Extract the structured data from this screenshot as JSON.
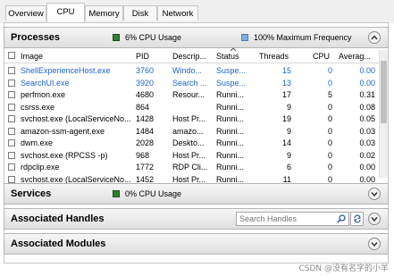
{
  "tabs": [
    {
      "label": "Overview"
    },
    {
      "label": "CPU"
    },
    {
      "label": "Memory"
    },
    {
      "label": "Disk"
    },
    {
      "label": "Network"
    }
  ],
  "active_tab": "CPU",
  "processes": {
    "title": "Processes",
    "cpu_usage": "6% CPU Usage",
    "max_frequency": "100% Maximum Frequency",
    "columns": [
      "Image",
      "PID",
      "Descrip...",
      "Status",
      "Threads",
      "CPU",
      "Averag..."
    ],
    "rows": [
      {
        "image": "ShellExperienceHost.exe",
        "pid": "3760",
        "desc": "Windo...",
        "status": "Suspe...",
        "threads": "15",
        "cpu": "0",
        "avg": "0.00",
        "highlight": true
      },
      {
        "image": "SearchUI.exe",
        "pid": "3920",
        "desc": "Search ...",
        "status": "Suspe...",
        "threads": "13",
        "cpu": "0",
        "avg": "0.00",
        "highlight": true
      },
      {
        "image": "perfmon.exe",
        "pid": "4680",
        "desc": "Resour...",
        "status": "Runni...",
        "threads": "17",
        "cpu": "5",
        "avg": "0.31",
        "highlight": false
      },
      {
        "image": "csrss.exe",
        "pid": "864",
        "desc": "",
        "status": "Runni...",
        "threads": "9",
        "cpu": "0",
        "avg": "0.08",
        "highlight": false
      },
      {
        "image": "svchost.exe (LocalServiceNo...",
        "pid": "1428",
        "desc": "Host Pr...",
        "status": "Runni...",
        "threads": "19",
        "cpu": "0",
        "avg": "0.05",
        "highlight": false
      },
      {
        "image": "amazon-ssm-agent.exe",
        "pid": "1484",
        "desc": "amazo...",
        "status": "Runni...",
        "threads": "9",
        "cpu": "0",
        "avg": "0.03",
        "highlight": false
      },
      {
        "image": "dwm.exe",
        "pid": "2028",
        "desc": "Deskto...",
        "status": "Runni...",
        "threads": "14",
        "cpu": "0",
        "avg": "0.03",
        "highlight": false
      },
      {
        "image": "svchost.exe (RPCSS -p)",
        "pid": "968",
        "desc": "Host Pr...",
        "status": "Runni...",
        "threads": "9",
        "cpu": "0",
        "avg": "0.02",
        "highlight": false
      },
      {
        "image": "rdpclip.exe",
        "pid": "1772",
        "desc": "RDP Cli...",
        "status": "Runni...",
        "threads": "6",
        "cpu": "0",
        "avg": "0.00",
        "highlight": false
      },
      {
        "image": "svchost.exe (LocalServiceNo...",
        "pid": "1452",
        "desc": "Host Pr...",
        "status": "Runni...",
        "threads": "11",
        "cpu": "0",
        "avg": "0.00",
        "highlight": false
      }
    ]
  },
  "services": {
    "title": "Services",
    "cpu_usage": "0% CPU Usage"
  },
  "handles": {
    "title": "Associated Handles",
    "search_placeholder": "Search Handles"
  },
  "modules": {
    "title": "Associated Modules"
  },
  "watermark": "CSDN @没有名字的小羊",
  "colors": {
    "accent_blue": "#1e63c8",
    "cpu_green": "#2f7f2f",
    "freq_blue": "#7aaedc"
  }
}
